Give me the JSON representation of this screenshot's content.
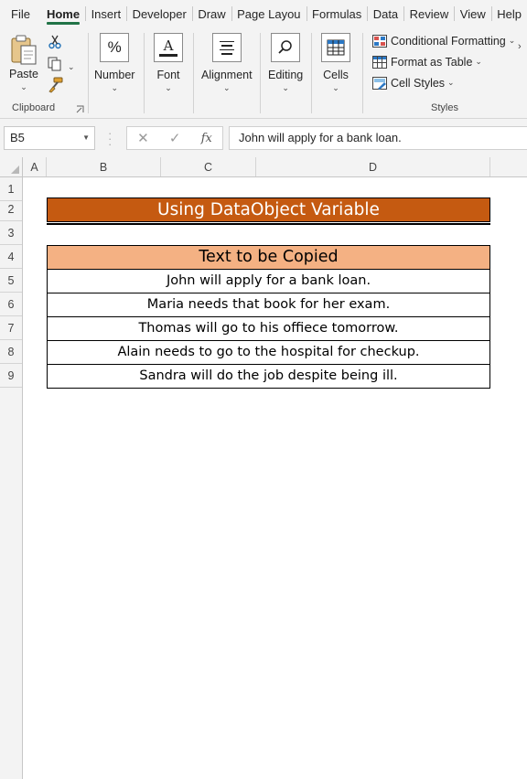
{
  "ribbon_tabs": [
    "File",
    "Home",
    "Insert",
    "Developer",
    "Draw",
    "Page Layou",
    "Formulas",
    "Data",
    "Review",
    "View",
    "Help"
  ],
  "active_tab": "Home",
  "clipboard": {
    "paste_label": "Paste",
    "group_label": "Clipboard"
  },
  "groups": {
    "number_label": "Number",
    "font_label": "Font",
    "alignment_label": "Alignment",
    "editing_label": "Editing",
    "cells_label": "Cells"
  },
  "styles": {
    "conditional_formatting": "Conditional Formatting",
    "format_as_table": "Format as Table",
    "cell_styles": "Cell Styles",
    "group_label": "Styles"
  },
  "formula_bar": {
    "name_box": "B5",
    "fx_symbol": "fx",
    "formula": "John will apply for a bank loan."
  },
  "columns": [
    "A",
    "B",
    "C",
    "D"
  ],
  "rows": [
    "1",
    "2",
    "3",
    "4",
    "5",
    "6",
    "7",
    "8",
    "9"
  ],
  "sheet": {
    "title": "Using DataObject Variable",
    "table_header": "Text to be Copied",
    "table_rows": [
      "John will apply for a bank loan.",
      "Maria needs that book for her exam.",
      "Thomas will go to his offiece tomorrow.",
      "Alain needs to go to the hospital for checkup.",
      "Sandra will do the job despite being ill."
    ]
  },
  "colors": {
    "title_fill": "#c55a11",
    "header_fill": "#f4b183",
    "accent": "#217346"
  }
}
